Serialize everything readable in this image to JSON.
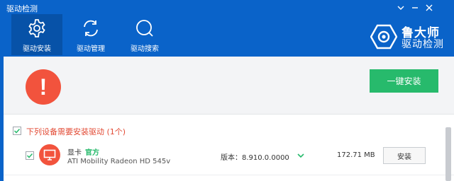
{
  "window": {
    "title": "驱动检测",
    "controls": [
      {
        "name": "window-menu-button",
        "icon": "chevron-down-icon"
      },
      {
        "name": "window-minimize-button",
        "icon": "minimize-icon"
      },
      {
        "name": "window-close-button",
        "icon": "close-icon"
      }
    ]
  },
  "tabs": [
    {
      "label": "驱动安装",
      "icon": "gear-icon",
      "active": true
    },
    {
      "label": "驱动管理",
      "icon": "refresh-icon",
      "active": false
    },
    {
      "label": "驱动搜索",
      "icon": "search-icon",
      "active": false
    }
  ],
  "brand": {
    "name": "鲁大师",
    "subtitle": "驱动检测",
    "icon": "lu-dashi-logo-icon"
  },
  "alert": {
    "icon": "exclamation-icon",
    "symbol": "!",
    "install_all_label": "一键安装"
  },
  "section": {
    "title": "下列设备需要安装驱动 (1个)",
    "checked": true
  },
  "devices": [
    {
      "name": "显卡",
      "badge": "官方",
      "model": "ATI Mobility Radeon HD 545v",
      "version": "版本：8.910.0.0000",
      "size": "172.71 MB",
      "install_label": "安装",
      "checked": true,
      "icon": "monitor-icon"
    }
  ],
  "colors": {
    "header_blue": "#0a63c9",
    "active_tab": "#0752a8",
    "alert_red": "#f2533d",
    "action_green": "#27ba6c",
    "section_title_red": "#e24a34"
  }
}
